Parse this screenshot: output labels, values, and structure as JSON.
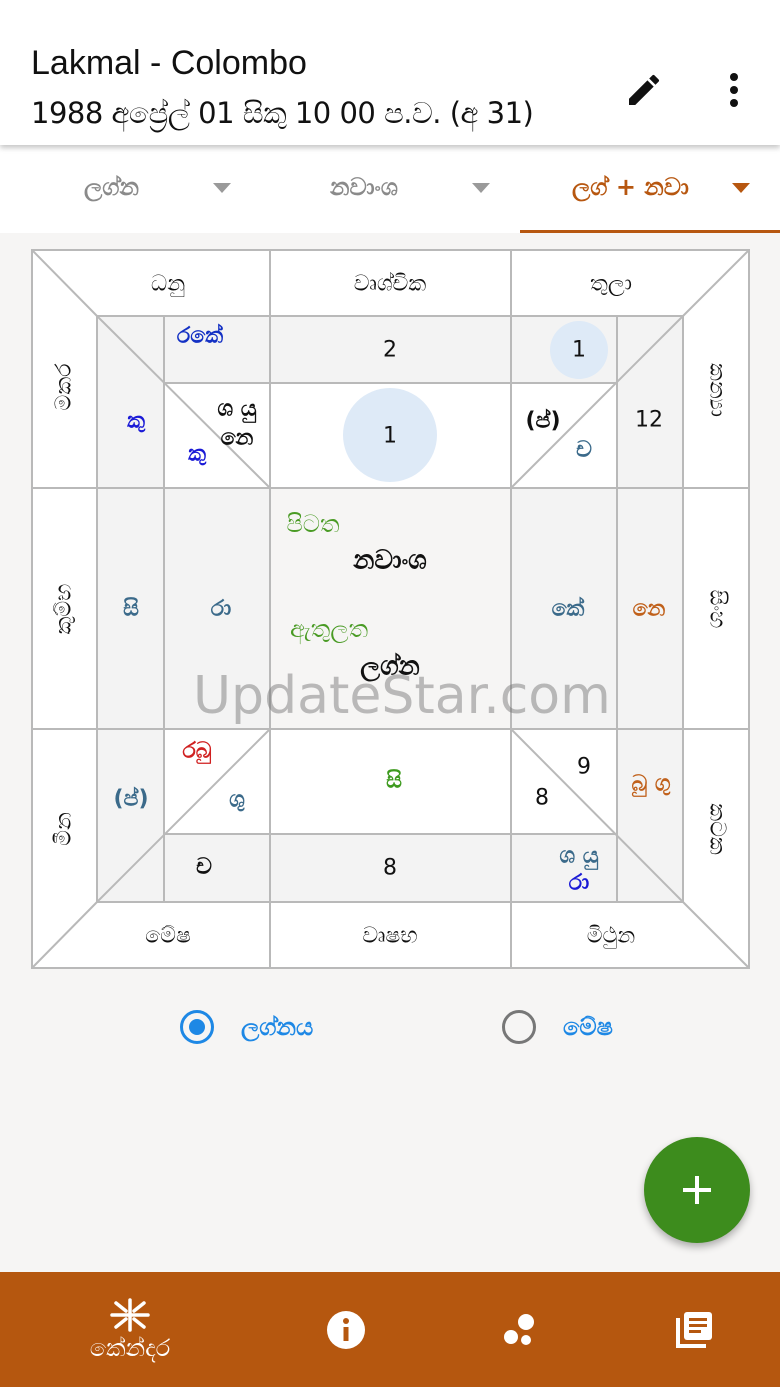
{
  "header": {
    "title": "Lakmal - Colombo",
    "subtitle": "1988 අප්‍රේල් 01 සිකු 10 00 ප.ව. (අ 31)",
    "edit_icon": "pencil-icon",
    "menu_icon": "more-vert-icon"
  },
  "tabs": [
    {
      "label": "ලග්න",
      "active": false
    },
    {
      "label": "නවාංශ",
      "active": false
    },
    {
      "label": "ලග් + නවා",
      "active": true
    }
  ],
  "chart": {
    "signs": {
      "dhanu": "ධනු",
      "vrushchika": "වෘශ්චික",
      "thula": "තුලා",
      "makara": "මකර",
      "kanya": "කන්‍යා",
      "kumbha": "කුම්භ",
      "simha": "සිංහ",
      "meena": "මීන",
      "kataka": "කටක",
      "mesha": "මේෂ",
      "vrushabha": "වෘෂභ",
      "mithuna": "මිථුන"
    },
    "cells": {
      "dhanu_top": "රකේ",
      "dhanu_left": "කු",
      "dhanu_inner_1": "ශ යු",
      "dhanu_inner_2": "නෙ",
      "dhanu_inner_3": "කු",
      "vrush_num": "2",
      "center_top_num": "1",
      "thula_num": "1",
      "thula_inner_1": "(ප්)",
      "thula_inner_2": "ච",
      "kanya_num": "12",
      "kumbha_outer": "සි",
      "kumbha_inner": "රා",
      "center_top_label": "පිටත",
      "center_top_value": "නවාංශ",
      "center_bottom_label": "ඇතුලත",
      "center_bottom_value": "ලග්න",
      "simha_inner": "කේ",
      "simha_outer": "නෙ",
      "meena_outer": "(ප්)",
      "meena_inner_1": "රබු",
      "meena_inner_2": "ශු",
      "mesha_inner": "ච",
      "vrushabha_top": "සි",
      "vrushabha_num": "8",
      "mithuna_num_1": "9",
      "mithuna_num_2": "8",
      "kataka_outer": "බු ගු",
      "mithuna_inner_1": "ශ යු",
      "mithuna_inner_2": "රා"
    }
  },
  "watermark": "UpdateStar.com",
  "radio": {
    "option1": "ලග්නය",
    "option2": "මේෂ",
    "selected": "ලග්නය"
  },
  "fab_icon": "plus-icon",
  "bottom_nav": [
    {
      "icon": "asterisk-icon",
      "label": "කේන්දර"
    },
    {
      "icon": "info-icon",
      "label": ""
    },
    {
      "icon": "bubbles-icon",
      "label": ""
    },
    {
      "icon": "list-icon",
      "label": ""
    }
  ],
  "colors": {
    "accent": "#b5570f",
    "fab": "#3d8c1d",
    "blue": "#1e88e5",
    "green": "#3d9a1e"
  }
}
